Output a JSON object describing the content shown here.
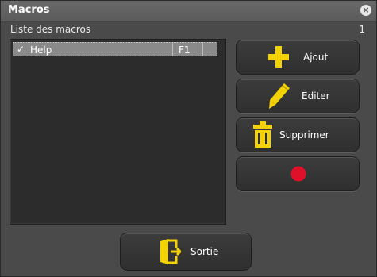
{
  "window": {
    "title": "Macros",
    "close_glyph": "×"
  },
  "list_header": {
    "label": "Liste des macros",
    "count": "1"
  },
  "macros": [
    {
      "check": "✓",
      "name": "Help",
      "key": "F1"
    }
  ],
  "buttons": {
    "add": {
      "label": "Ajout",
      "icon": "plus-icon",
      "color": "#f2d200"
    },
    "edit": {
      "label": "Editer",
      "icon": "pencil-icon",
      "color": "#f2d200"
    },
    "delete": {
      "label": "Supprimer",
      "icon": "trash-icon",
      "color": "#f2d200"
    },
    "record": {
      "icon": "record-icon",
      "color": "#e0102a"
    },
    "exit": {
      "label": "Sortie",
      "icon": "exit-door-icon",
      "color": "#f2d200"
    }
  }
}
